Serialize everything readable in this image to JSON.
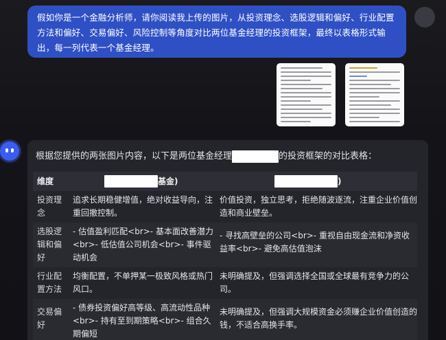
{
  "user": {
    "message": "假如你是一个金融分析师，请你阅读我上传的图片，从投资理念、选股逻辑和偏好、行业配置方法和偏好、交易偏好、风险控制等角度对比两位基金经理的投资框架，最终以表格形式输出，每一列代表一个基金经理。"
  },
  "assistant": {
    "intro_before": "根据您提供的两张图片内容，以下是两位基金经理",
    "intro_after": "的投资框架的对比表格："
  },
  "table": {
    "header_dimension": "维度",
    "header_manager_1_suffix": "基金)",
    "header_manager_2_suffix": ")",
    "rows": [
      {
        "dimension": "投资理念",
        "manager_1": "追求长期稳健增值，绝对收益导向，注重回撤控制。",
        "manager_2": "价值投资，独立思考，拒绝随波逐流，注重企业价值创造和商业壁垒。"
      },
      {
        "dimension": "选股逻辑和偏好",
        "manager_1": "- 估值盈利匹配<br>- 基本面改善潜力<br>- 低估值公司机会<br>- 事件驱动机会",
        "manager_2": "- 寻找高壁垒的公司<br>- 重视自由现金流和净资收益率<br>- 避免高估值泡沫"
      },
      {
        "dimension": "行业配置方法",
        "manager_1": "均衡配置，不单押某一极致风格或热门风口。",
        "manager_2": "未明确提及，但强调选择全国或全球最有竞争力的公司。"
      },
      {
        "dimension": "交易偏好",
        "manager_1": "- 债券投资偏好高等级、高流动性品种<br>- 持有至到期策略<br>- 组合久期偏短",
        "manager_2": "未明确提及，但强调大规模资金必须赚企业价值创造的钱，不适合高换手率。"
      }
    ]
  }
}
